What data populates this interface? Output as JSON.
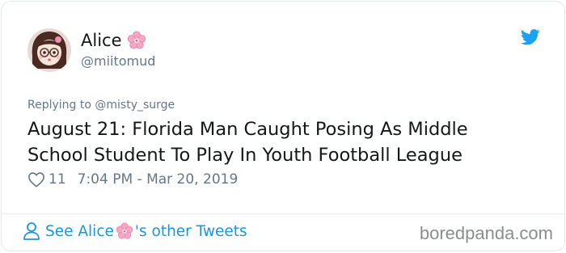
{
  "user": {
    "display_name": "Alice",
    "handle": "@miitomud"
  },
  "tweet": {
    "replying_to": "Replying to @misty_surge",
    "text": "August 21: Florida Man Caught Posing As Middle School Student To Play In Youth Football League",
    "like_count": "11",
    "timestamp": "7:04 PM - Mar 20, 2019"
  },
  "footer": {
    "see_prefix": "See Alice",
    "see_suffix": "'s other Tweets"
  },
  "watermark": "boredpanda.com",
  "icons": {
    "brand": "twitter-bird-icon",
    "like": "heart-icon",
    "profile": "person-icon",
    "emoji": "cherry-blossom-icon"
  },
  "colors": {
    "link": "#1b95e0",
    "text": "#14171a",
    "muted": "#657786",
    "twitter": "#1da1f2",
    "flower": "#f7a6c4"
  }
}
